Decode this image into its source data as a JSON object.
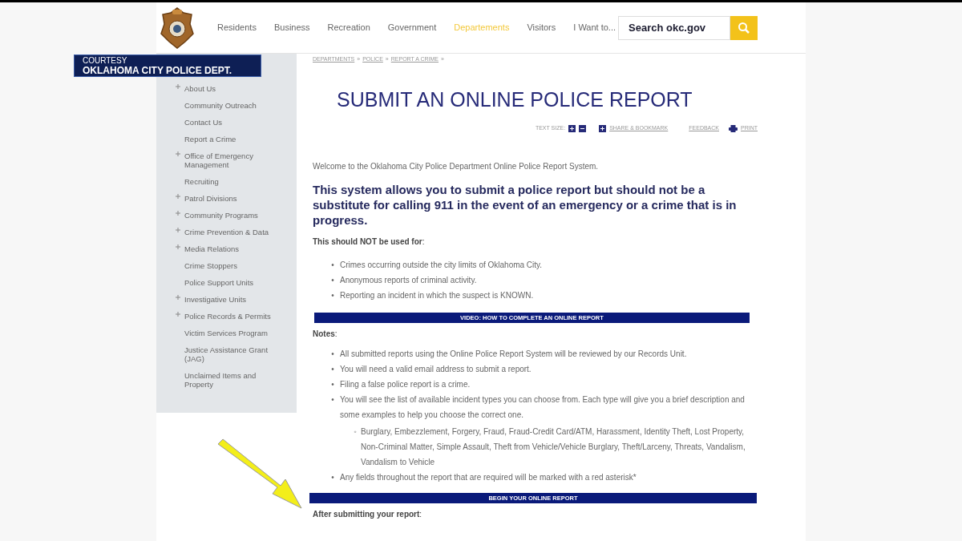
{
  "header": {
    "nav": [
      {
        "label": "Residents",
        "selected": false
      },
      {
        "label": "Business",
        "selected": false
      },
      {
        "label": "Recreation",
        "selected": false
      },
      {
        "label": "Government",
        "selected": false
      },
      {
        "label": "Departements",
        "selected": true
      },
      {
        "label": "Visitors",
        "selected": false
      },
      {
        "label": "I Want to...",
        "selected": false
      }
    ],
    "search": {
      "placeholder": "Search okc.gov"
    }
  },
  "caption": {
    "line1": "COURTESY",
    "line2": "OKLAHOMA CITY POLICE DEPT."
  },
  "sidebar": {
    "items": [
      {
        "label": "About Us",
        "expandable": true
      },
      {
        "label": "Community Outreach",
        "expandable": false
      },
      {
        "label": "Contact Us",
        "expandable": false
      },
      {
        "label": "Report a Crime",
        "expandable": false
      },
      {
        "label": "Office of Emergency Management",
        "expandable": true
      },
      {
        "label": "Recruiting",
        "expandable": false
      },
      {
        "label": "Patrol Divisions",
        "expandable": true
      },
      {
        "label": "Community Programs",
        "expandable": true
      },
      {
        "label": "Crime Prevention & Data",
        "expandable": true
      },
      {
        "label": "Media Relations",
        "expandable": true
      },
      {
        "label": "Crime Stoppers",
        "expandable": false
      },
      {
        "label": "Police Support Units",
        "expandable": false
      },
      {
        "label": "Investigative Units",
        "expandable": true
      },
      {
        "label": "Police Records & Permits",
        "expandable": true
      },
      {
        "label": "Victim Services Program",
        "expandable": false
      },
      {
        "label": "Justice Assistance Grant (JAG)",
        "expandable": false
      },
      {
        "label": "Unclaimed Items and Property",
        "expandable": false
      }
    ]
  },
  "breadcrumb": [
    "DEPARTMENTS",
    "POLICE",
    "REPORT A CRIME"
  ],
  "breadcrumb_separator": "»",
  "bullet": "•",
  "sub_bullet": "◦",
  "title": "SUBMIT AN ONLINE POLICE REPORT",
  "tools": {
    "text_size": "TEXT SIZE:",
    "share": "SHARE & BOOKMARK",
    "feedback": "FEEDBACK",
    "print": "PRINT"
  },
  "welcome": "Welcome to the Oklahoma City Police Department Online Police Report System.",
  "notice": "This system allows you to submit a police report but should not be a substitute for calling 911 in the event of an emergency or a crime that is in progress.",
  "not_used_heading": "**This should NOT be used for**:",
  "not_used_items": [
    "Crimes occurring outside the city limits of Oklahoma City.",
    "Anonymous reports of criminal activity.",
    "Reporting an incident in which the suspect is KNOWN."
  ],
  "video_bar": "VIDEO: HOW TO COMPLETE AN ONLINE REPORT",
  "notes_heading": "**Notes**:",
  "notes": [
    {
      "text": "All submitted reports using the Online Police Report System will be reviewed by our Records Unit."
    },
    {
      "text": "You will need a valid email address to submit a report."
    },
    {
      "text": "Filing a false police report is a crime."
    },
    {
      "text": "You will see the list of available incident types you can choose from. Each type will give you a brief description and some examples to help you choose the correct one.",
      "children": [
        {
          "text": "Burglary, Embezzlement, Forgery, Fraud, Fraud-Credit Card/ATM, Harassment, Identity Theft, Lost Property, Non-Criminal Matter, Simple Assault, Theft from Vehicle/Vehicle Burglary, Theft/Larceny, Threats, Vandalism, Vandalism to Vehicle"
        }
      ]
    },
    {
      "text": "Any fields throughout the report that are required will be marked with a red asterisk*"
    }
  ],
  "begin_bar": "BEGIN YOUR ONLINE REPORT",
  "after_heading": "**After submitting your report**:"
}
